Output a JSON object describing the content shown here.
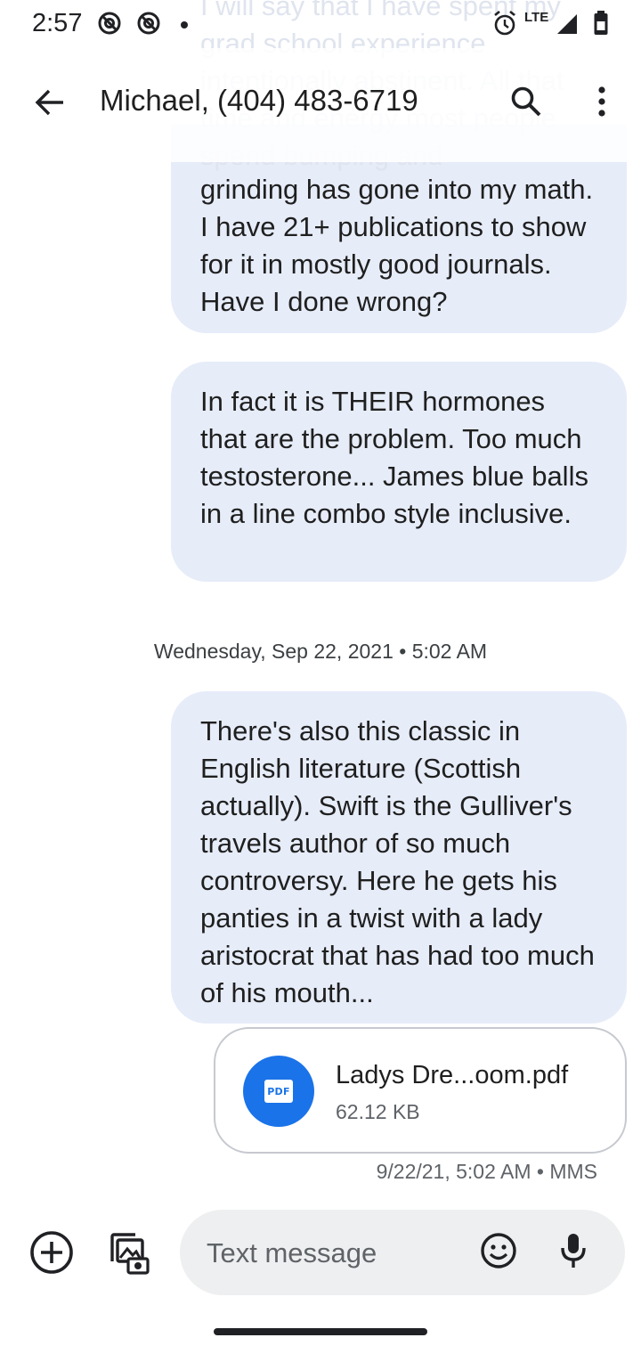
{
  "status_bar": {
    "time": "2:57",
    "network_label": "LTE",
    "icons": [
      "at-sign-icon",
      "at-sign-icon",
      "notification-dot-icon",
      "alarm-icon",
      "signal-icon",
      "battery-icon"
    ]
  },
  "header": {
    "title": "Michael, (404) 483-6719",
    "icons": [
      "back-arrow-icon",
      "search-icon",
      "more-vert-icon"
    ]
  },
  "conversation": {
    "ghost_text": "I will say that I have spent my grad school experience intentionally abstinent. All that time and energy most people spend bumping and",
    "messages": [
      {
        "text": "grinding has gone into my math. I have 21+ publications to show for it in mostly good journals. Have I done wrong?"
      },
      {
        "text": "In fact it is THEIR hormones that are the problem. Too much testosterone... James blue balls in a line combo style inclusive."
      },
      {
        "text": "There's also this classic in English literature (Scottish actually). Swift is the Gulliver's travels author of so much controversy. Here he gets his panties in a twist with a lady aristocrat that has had too much of his mouth..."
      }
    ],
    "date_separator": "Wednesday, Sep 22, 2021 • 5:02 AM",
    "attachment": {
      "icon": "pdf-icon",
      "badge": "PDF",
      "name": "Ladys Dre...oom.pdf",
      "size": "62.12 KB"
    },
    "message_meta": "9/22/21, 5:02 AM • MMS"
  },
  "composer": {
    "placeholder": "Text message",
    "icons": [
      "add-circle-icon",
      "gallery-icon",
      "emoji-icon",
      "microphone-icon"
    ]
  },
  "colors": {
    "bubble": "#e6ecf8",
    "accent": "#1a73e8",
    "input_background": "#eeeff0"
  }
}
